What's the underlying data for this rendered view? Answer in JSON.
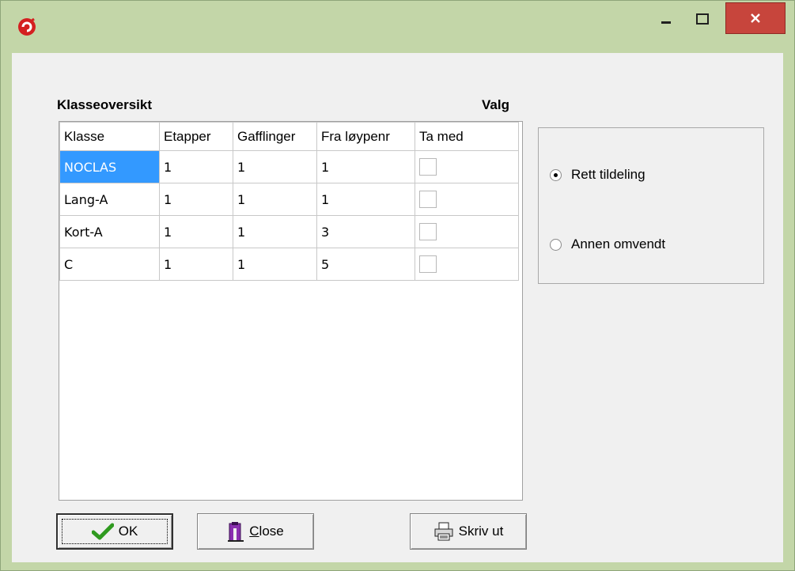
{
  "window": {
    "app_icon": "app-logo-icon",
    "controls": {
      "minimize": "minimize-icon",
      "maximize": "maximize-icon",
      "close": "close-icon"
    }
  },
  "left_caption": "Klasseoversikt",
  "right_caption": "Valg",
  "table": {
    "columns": [
      "Klasse",
      "Etapper",
      "Gafflinger",
      "Fra løypenr",
      "Ta med"
    ],
    "rows": [
      {
        "klasse": "NOCLAS",
        "etapper": "1",
        "gafflinger": "1",
        "fra": "1",
        "ta_med": false,
        "selected": true
      },
      {
        "klasse": "Lang-A",
        "etapper": "1",
        "gafflinger": "1",
        "fra": "1",
        "ta_med": false,
        "selected": false
      },
      {
        "klasse": "Kort-A",
        "etapper": "1",
        "gafflinger": "1",
        "fra": "3",
        "ta_med": false,
        "selected": false
      },
      {
        "klasse": "C",
        "etapper": "1",
        "gafflinger": "1",
        "fra": "5",
        "ta_med": false,
        "selected": false
      }
    ]
  },
  "options": {
    "rett": {
      "label": "Rett tildeling",
      "checked": true
    },
    "annen": {
      "label": "Annen omvendt",
      "checked": false
    }
  },
  "buttons": {
    "ok": {
      "label": "OK",
      "icon": "checkmark-icon"
    },
    "close": {
      "label_first": "C",
      "label_rest": "lose",
      "icon": "door-exit-icon"
    },
    "print": {
      "label": "Skriv ut",
      "icon": "printer-icon"
    }
  },
  "colors": {
    "selection": "#3399ff",
    "title_bar": "#c3d6a8",
    "close_button": "#c7453c",
    "ok_check": "#2f9a1f"
  }
}
